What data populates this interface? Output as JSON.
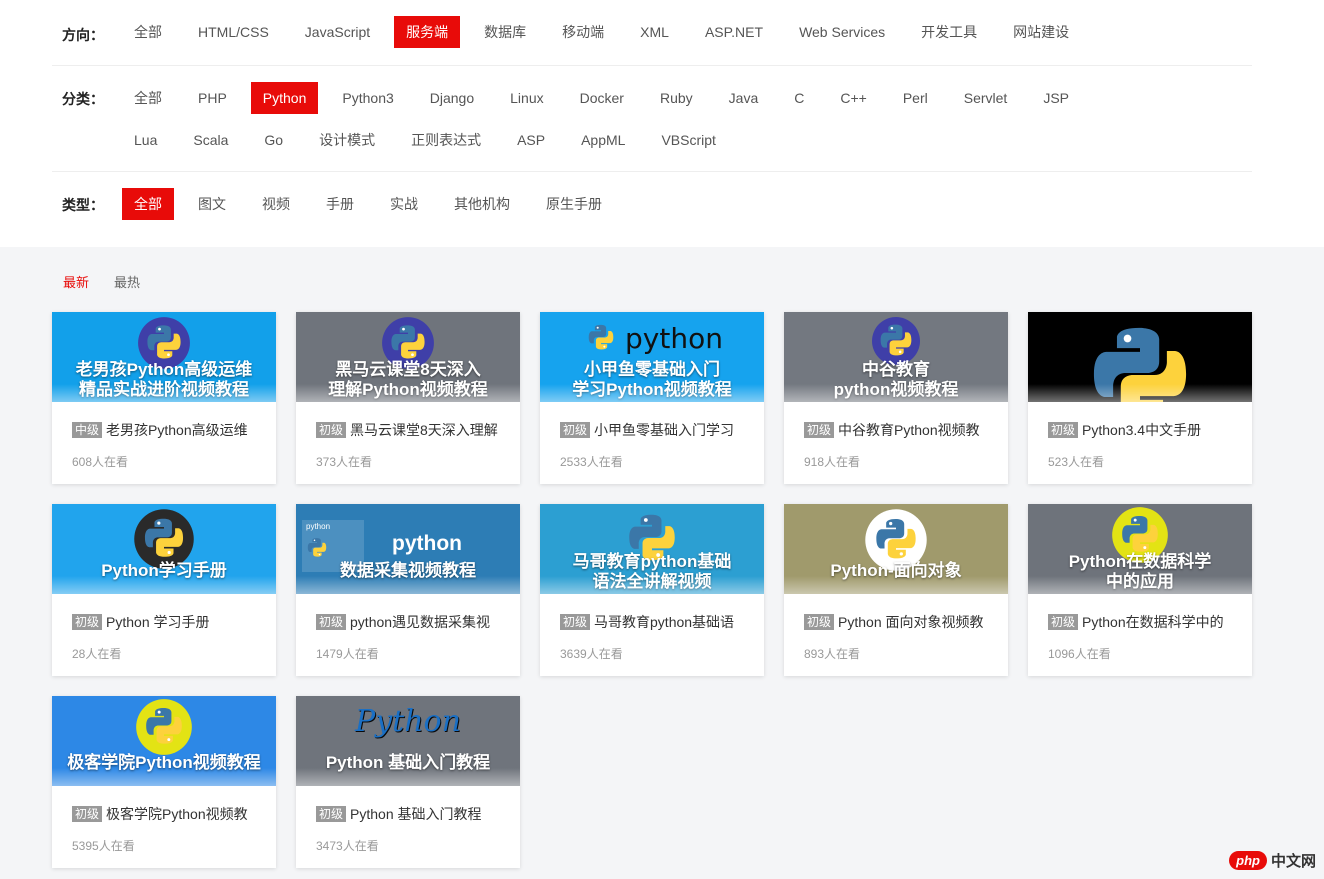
{
  "filters": {
    "direction": {
      "label": "方向：",
      "options": [
        "全部",
        "HTML/CSS",
        "JavaScript",
        "服务端",
        "数据库",
        "移动端",
        "XML",
        "ASP.NET",
        "Web Services",
        "开发工具",
        "网站建设"
      ],
      "selected": 3
    },
    "category": {
      "label": "分类：",
      "options": [
        "全部",
        "PHP",
        "Python",
        "Python3",
        "Django",
        "Linux",
        "Docker",
        "Ruby",
        "Java",
        "C",
        "C++",
        "Perl",
        "Servlet",
        "JSP",
        "Lua",
        "Scala",
        "Go",
        "设计模式",
        "正则表达式",
        "ASP",
        "AppML",
        "VBScript"
      ],
      "selected": 2
    },
    "type": {
      "label": "类型：",
      "options": [
        "全部",
        "图文",
        "视频",
        "手册",
        "实战",
        "其他机构",
        "原生手册"
      ],
      "selected": 0
    }
  },
  "sort": {
    "options": [
      "最新",
      "最热"
    ],
    "selected": 0
  },
  "courses": [
    {
      "thumb_title": [
        "老男孩Python高级运维",
        "精品实战进阶视频教程"
      ],
      "thumb_bg": "#12a0ea",
      "level": "中级",
      "title": "老男孩Python高级运维",
      "views": "608人在看"
    },
    {
      "thumb_title": [
        "黑马云课堂8天深入",
        "理解Python视频教程"
      ],
      "thumb_bg": "#6f747c",
      "level": "初级",
      "title": "黑马云课堂8天深入理解",
      "views": "373人在看"
    },
    {
      "thumb_title": [
        "小甲鱼零基础入门",
        "学习Python视频教程"
      ],
      "thumb_bg": "#16a3ee",
      "thumb_brand": "python",
      "level": "初级",
      "title": "小甲鱼零基础入门学习",
      "views": "2533人在看"
    },
    {
      "thumb_title": [
        "中谷教育",
        "python视频教程"
      ],
      "thumb_bg": "#737880",
      "level": "初级",
      "title": "中谷教育Python视频教",
      "views": "918人在看"
    },
    {
      "thumb_title": [],
      "thumb_bg": "#000000",
      "level": "初级",
      "title": "Python3.4中文手册",
      "views": "523人在看"
    },
    {
      "thumb_title": [
        "Python学习手册"
      ],
      "thumb_bg": "#21a4ed",
      "level": "初级",
      "title": "Python 学习手册",
      "views": "28人在看"
    },
    {
      "thumb_title": [
        "数据采集视频教程"
      ],
      "thumb_bg": "#2d7db5",
      "thumb_brand": "python",
      "thumb_small": "python",
      "level": "初级",
      "title": "python遇见数据采集视",
      "views": "1479人在看"
    },
    {
      "thumb_title": [
        "马哥教育python基础",
        "语法全讲解视频"
      ],
      "thumb_bg": "#2c9fd2",
      "level": "初级",
      "title": "马哥教育python基础语",
      "views": "3639人在看"
    },
    {
      "thumb_title": [
        "Python-面向对象"
      ],
      "thumb_bg": "#a09a6c",
      "level": "初级",
      "title": "Python 面向对象视频教",
      "views": "893人在看"
    },
    {
      "thumb_title": [
        "Python在数据科学",
        "中的应用"
      ],
      "thumb_bg": "#6e737b",
      "level": "初级",
      "title": "Python在数据科学中的",
      "views": "1096人在看"
    },
    {
      "thumb_title": [
        "极客学院Python视频教程"
      ],
      "thumb_bg": "#2d88e6",
      "level": "初级",
      "title": "极客学院Python视频教",
      "views": "5395人在看"
    },
    {
      "thumb_title": [
        "Python 基础入门教程"
      ],
      "thumb_bg": "#6f747c",
      "thumb_brand": "Python",
      "level": "初级",
      "title": "Python 基础入门教程",
      "views": "3473人在看"
    }
  ],
  "watermark": {
    "brand": "php",
    "text": "中文网"
  },
  "colors": {
    "accent": "#e80b09",
    "badge": "#999999"
  }
}
